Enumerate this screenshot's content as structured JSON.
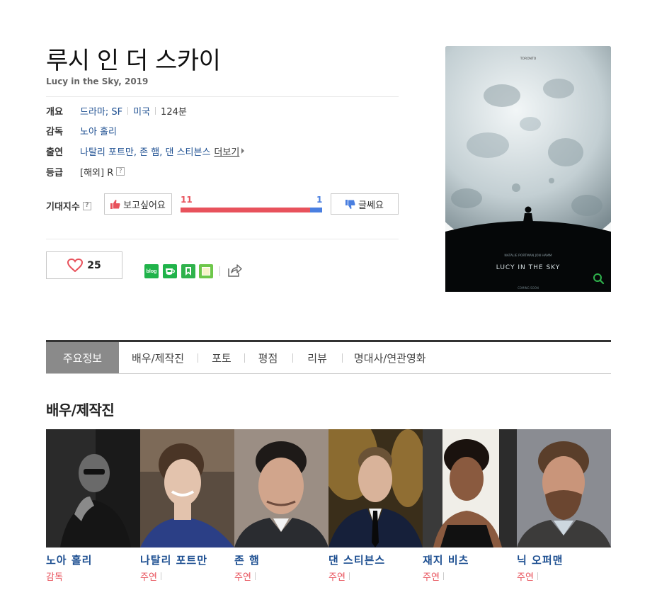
{
  "movie": {
    "title": "루시 인 더 스카이",
    "subtitle": "Lucy in the Sky, 2019"
  },
  "info": {
    "overview_label": "개요",
    "genre": "드라마; SF",
    "country": "미국",
    "runtime": "124분",
    "director_label": "감독",
    "director": "노아 홀리",
    "cast_label": "출연",
    "cast": "나탈리 포트만, 존 햄, 댄 스티븐스",
    "more_label": "더보기",
    "rating_label": "등급",
    "rating": "[해외] R"
  },
  "expectation": {
    "label": "기대지수",
    "want_label": "보고싶어요",
    "meh_label": "글쎄요",
    "want_count": "11",
    "meh_count": "1",
    "want_fraction": 0.917,
    "colors": {
      "want": "#e8525c",
      "meh": "#4a7fe0"
    }
  },
  "like": {
    "count": "25",
    "icon": "heart-icon"
  },
  "share": {
    "items": [
      "blog-icon",
      "cafe-icon",
      "band-icon",
      "memo-icon",
      "share-icon"
    ],
    "blog_text": "blog"
  },
  "poster": {
    "actors_line": "NATALIE PORTMAN   JON HAMM",
    "title_line": "LUCY IN THE SKY",
    "coming": "COMING SOON",
    "festival": "TORONTO"
  },
  "tabs": [
    {
      "label": "주요정보",
      "active": true
    },
    {
      "label": "배우/제작진",
      "active": false
    },
    {
      "label": "포토",
      "active": false
    },
    {
      "label": "평점",
      "active": false
    },
    {
      "label": "리뷰",
      "active": false
    },
    {
      "label": "명대사/연관영화",
      "active": false
    }
  ],
  "section": {
    "title": "배우/제작진"
  },
  "cast_list": [
    {
      "name": "노아 홀리",
      "role": "감독",
      "photo_bg": "#3a3a3a"
    },
    {
      "name": "나탈리 포트만",
      "role": "주연",
      "photo_bg": "#6b5a4a"
    },
    {
      "name": "존 햄",
      "role": "주연",
      "photo_bg": "#7a6e66"
    },
    {
      "name": "댄 스티븐스",
      "role": "주연",
      "photo_bg": "#8a6a30"
    },
    {
      "name": "재지 비츠",
      "role": "주연",
      "photo_bg": "#4a4640"
    },
    {
      "name": "닉 오퍼맨",
      "role": "주연",
      "photo_bg": "#6a6a72"
    }
  ]
}
